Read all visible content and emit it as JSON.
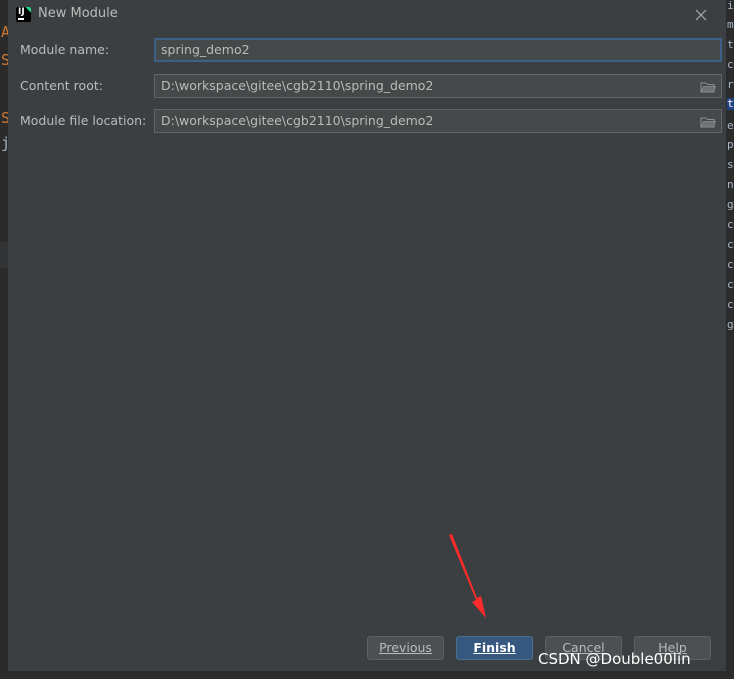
{
  "window": {
    "title": "New Module",
    "app_icon_text": "IJ"
  },
  "form": {
    "module_name": {
      "label": "Module name:",
      "value": "spring_demo2"
    },
    "content_root": {
      "label": "Content root:",
      "value": "D:\\workspace\\gitee\\cgb2110\\spring_demo2"
    },
    "module_file_location": {
      "label": "Module file location:",
      "value": "D:\\workspace\\gitee\\cgb2110\\spring_demo2"
    }
  },
  "buttons": {
    "previous": "Previous",
    "finish": "Finish",
    "cancel": "Cancel",
    "help": "Help"
  },
  "watermark": "CSDN @Double00lin",
  "background_editor": {
    "left_fragments": [
      "A",
      "S",
      "S",
      "j"
    ],
    "right_fragments": [
      "ic",
      "m",
      "t",
      "cl",
      "rif",
      "ta",
      "e",
      "p",
      "s",
      "nc",
      "g.",
      "c",
      "c",
      "c",
      "c",
      "c",
      "g."
    ]
  },
  "colors": {
    "dialog_bg": "#3c3f41",
    "field_bg": "#45494a",
    "focus_border": "#3d6185",
    "primary_button": "#365880",
    "annotation_arrow": "#ff2a2a"
  },
  "icons": {
    "close": "close-icon",
    "folder": "folder-icon",
    "app": "intellij-icon"
  }
}
